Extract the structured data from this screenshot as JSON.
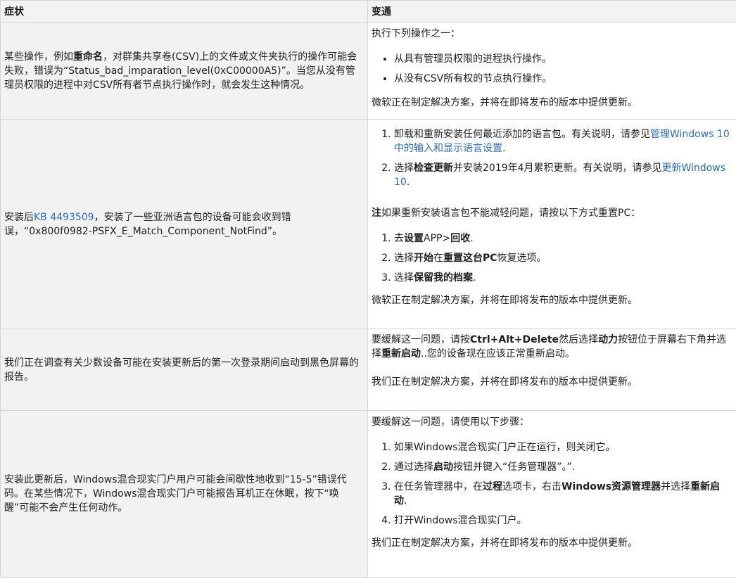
{
  "header": {
    "col1": "症状",
    "col2": "变通"
  },
  "rows": [
    {
      "symptom": {
        "t1": "某些操作，例如",
        "b1": "重命名",
        "t2": "，对群集共享卷(CSV)上的文件或文件夹执行的操作可能会失败，错误为“Status_bad_imparation_level(0xC00000A5)”。当您从没有管理员权限的进程中对CSV所有者节点执行操作时，就会发生这种情况。"
      },
      "workaround": {
        "intro": "执行下列操作之一：",
        "bullets": [
          "从具有管理员权限的进程执行操作。",
          "从没有CSV所有权的节点执行操作。"
        ],
        "note": "微软正在制定解决方案，并将在即将发布的版本中提供更新。"
      }
    },
    {
      "symptom": {
        "t1": "安装后",
        "link": "KB 4493509",
        "t2": "，安装了一些亚洲语言包的设备可能会收到错误，“0x800f0982-PSFX_E_Match_Component_NotFind”。"
      },
      "workaround": {
        "s1_text": "卸载和重新安装任何最近添加的语言包。有关说明，请参见",
        "s1_link": "管理Windows 10中的输入和显示语言设置",
        "s1_end": ".",
        "s2_t1": "选择",
        "s2_b1": "检查更新",
        "s2_t2": "并安装2019年4月累积更新。有关说明，请参见",
        "s2_link": "更新Windows 10",
        "s2_end": ".",
        "note_b": "注",
        "note_t": "如果重新安装语言包不能减轻问题，请按以下方式重置PC：",
        "r1_t1": "去",
        "r1_b1": "设置",
        "r1_t2": "APP>",
        "r1_b2": "回收",
        "r1_end": ".",
        "r2_t1": "选择",
        "r2_b1": "开始",
        "r2_t2": "在",
        "r2_b2": "重置这台PC",
        "r2_t3": "恢复选项。",
        "r3_t1": "选择",
        "r3_b1": "保留我的档案",
        "r3_end": ".",
        "footer": "微软正在制定解决方案，并将在即将发布的版本中提供更新。"
      }
    },
    {
      "symptom": {
        "text": "我们正在调查有关少数设备可能在安装更新后的第一次登录期间启动到黑色屏幕的报告。"
      },
      "workaround": {
        "t1": "要缓解这一问题，请按",
        "b1": "Ctrl+Alt+Delete",
        "t2": "然后选择",
        "b2": "动力",
        "t3": "按钮位于屏幕右下角并选择",
        "b3": "重新启动",
        "t4": "..您的设备现在应该正常重新启动。",
        "footer": "我们正在制定解决方案，并将在即将发布的版本中提供更新。"
      }
    },
    {
      "symptom": {
        "text": "安装此更新后，Windows混合现实门户用户可能会间歇性地收到“15-5”错误代码。在某些情况下，Windows混合现实门户可能报告耳机正在休眠，按下“唤醒”可能不会产生任何动作。"
      },
      "workaround": {
        "intro": "要缓解这一问题，请使用以下步骤：",
        "s1": "如果Windows混合现实门户正在运行，则关闭它。",
        "s2_t1": "通过选择",
        "s2_b1": "启动",
        "s2_t2": "按钮并键入“任务管理器”。”.",
        "s3_t1": "在任务管理器中，在",
        "s3_b1": "过程",
        "s3_t2": "选项卡，右击",
        "s3_b2": "Windows资源管理器",
        "s3_t3": "并选择",
        "s3_b3": "重新启动",
        "s3_end": ".",
        "s4": "打开Windows混合现实门户。",
        "footer": "我们正在制定解决方案，并将在即将发布的版本中提供更新。"
      }
    }
  ],
  "colors": {
    "link": "#2d6db5",
    "header_bg": "#f3f3f3",
    "symptom_bg": "#f2f2f2",
    "border": "#d4d4d4"
  }
}
